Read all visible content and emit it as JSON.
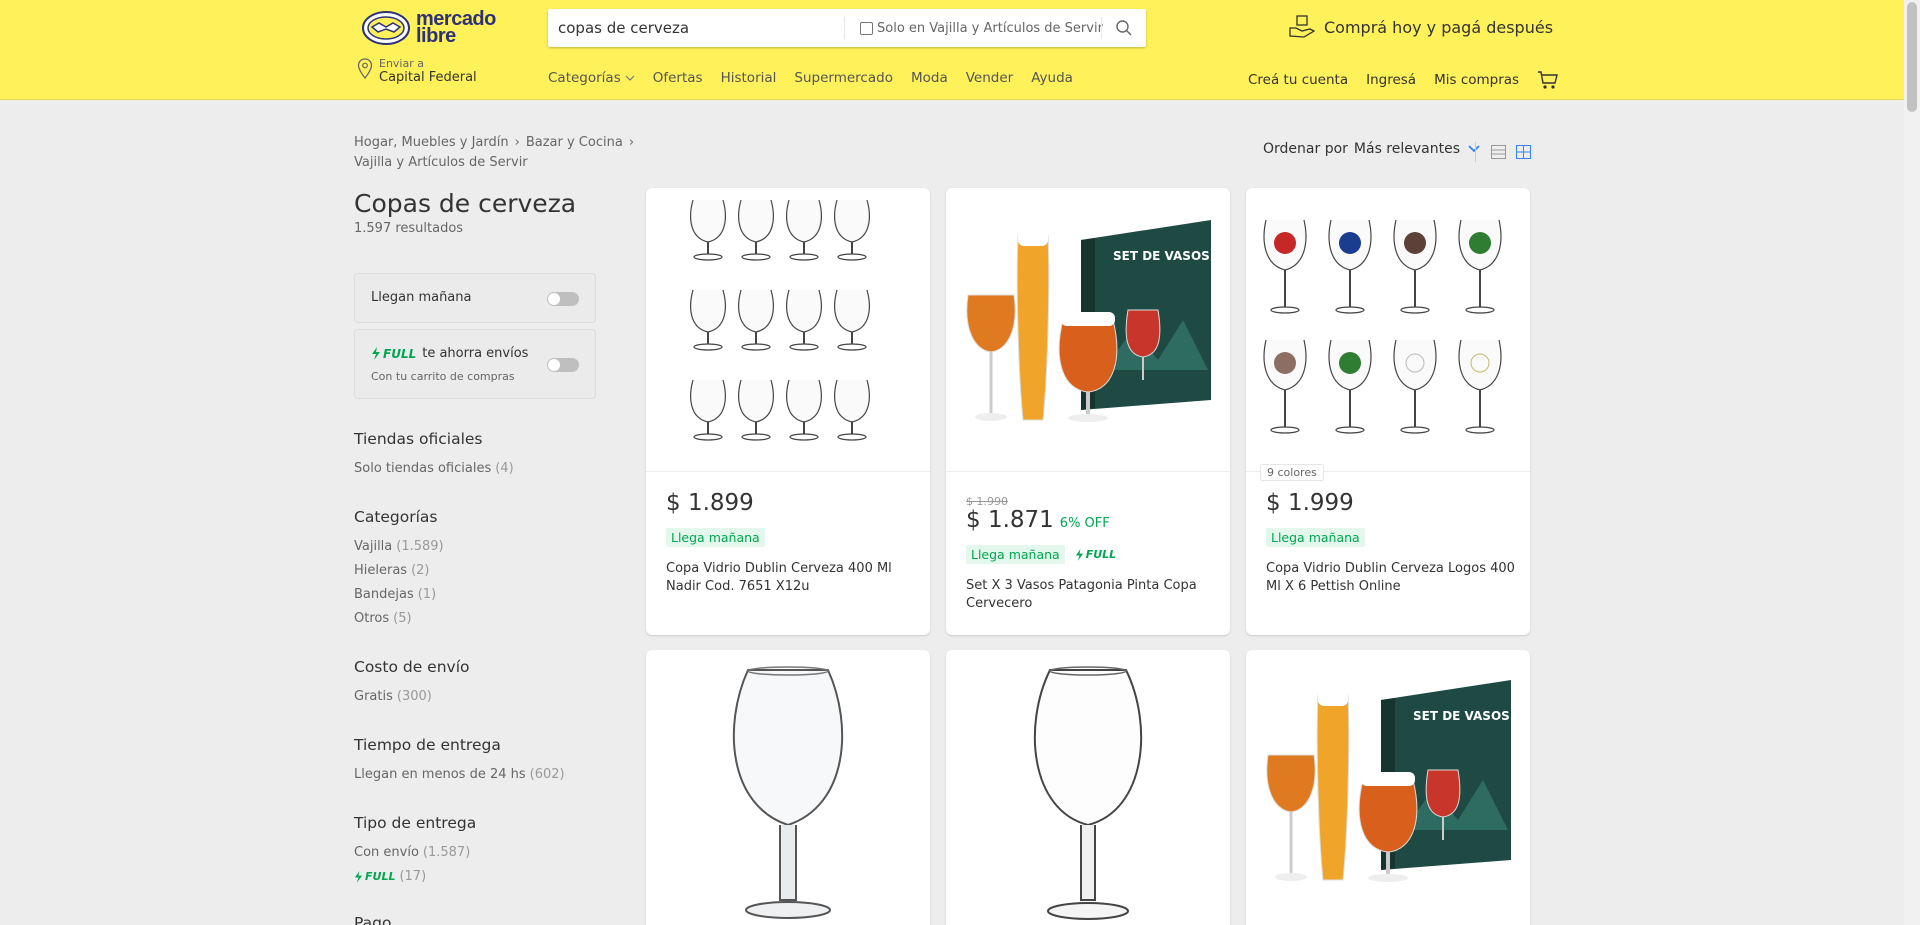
{
  "header": {
    "logo_text_1": "mercado",
    "logo_text_2": "libre",
    "search_value": "copas de cerveza",
    "search_checkbox_label": "Solo en Vajilla y Artículos de Servir",
    "promo": "Comprá hoy y pagá después",
    "location_small": "Enviar a",
    "location_big": "Capital Federal",
    "nav": [
      "Categorías",
      "Ofertas",
      "Historial",
      "Supermercado",
      "Moda",
      "Vender",
      "Ayuda"
    ],
    "account": [
      "Creá tu cuenta",
      "Ingresá",
      "Mis compras"
    ]
  },
  "breadcrumb": [
    "Hogar, Muebles y Jardín",
    "Bazar y Cocina",
    "Vajilla y Artículos de Servir"
  ],
  "page_title": "Copas de cerveza",
  "results": "1.597 resultados",
  "toggles": {
    "tomorrow": "Llegan mañana",
    "full_badge": "FULL",
    "full_text": "te ahorra envíos",
    "full_sub": "Con tu carrito de compras"
  },
  "filters": [
    {
      "heading": "Tiendas oficiales",
      "items": [
        {
          "label": "Solo tiendas oficiales",
          "count": "(4)"
        }
      ]
    },
    {
      "heading": "Categorías",
      "items": [
        {
          "label": "Vajilla",
          "count": "(1.589)"
        },
        {
          "label": "Hieleras",
          "count": "(2)"
        },
        {
          "label": "Bandejas",
          "count": "(1)"
        },
        {
          "label": "Otros",
          "count": "(5)"
        }
      ]
    },
    {
      "heading": "Costo de envío",
      "items": [
        {
          "label": "Gratis",
          "count": "(300)"
        }
      ]
    },
    {
      "heading": "Tiempo de entrega",
      "items": [
        {
          "label": "Llegan en menos de 24 hs",
          "count": "(602)"
        }
      ]
    },
    {
      "heading": "Tipo de entrega",
      "items": [
        {
          "label": "Con envío",
          "count": "(1.587)"
        },
        {
          "label": "FULL",
          "count": "(17)"
        }
      ]
    },
    {
      "heading": "Pago",
      "items": []
    }
  ],
  "sort": {
    "label": "Ordenar por",
    "value": "Más relevantes"
  },
  "products": [
    {
      "price": "$ 1.899",
      "badge": "Llega mañana",
      "title": "Copa Vidrio Dublin Cerveza 400 Ml Nadir Cod. 7651 X12u"
    },
    {
      "old_price": "$ 1.990",
      "price": "$ 1.871",
      "discount": "6% OFF",
      "badge": "Llega mañana",
      "full": "FULL",
      "title": "Set X 3 Vasos Patagonia Pinta Copa Cervecero"
    },
    {
      "colors": "9 colores",
      "price": "$ 1.999",
      "badge": "Llega mañana",
      "title": "Copa Vidrio Dublin Cerveza Logos 400 Ml X 6 Pettish Online"
    }
  ],
  "colors": {
    "header_bg": "#fff159",
    "green": "#00a650",
    "blue": "#3483fa",
    "logo": "#2d3277"
  }
}
